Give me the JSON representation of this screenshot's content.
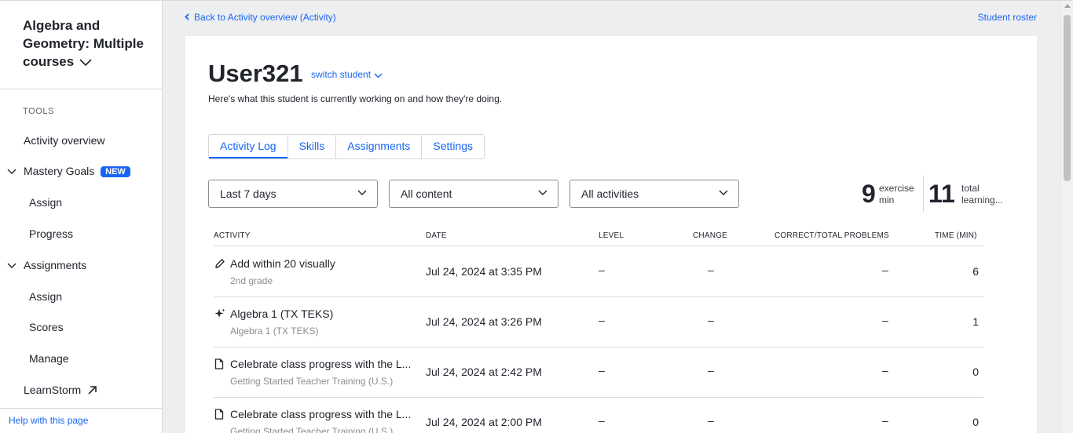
{
  "sidebar": {
    "course_title": "Algebra and Geometry: Multiple courses",
    "tools_label": "TOOLS",
    "activity_overview": "Activity overview",
    "mastery_goals": "Mastery Goals",
    "new_badge": "NEW",
    "mastery_assign": "Assign",
    "mastery_progress": "Progress",
    "assignments": "Assignments",
    "assignments_assign": "Assign",
    "assignments_scores": "Scores",
    "assignments_manage": "Manage",
    "learnstorm": "LearnStorm",
    "help": "Help with this page"
  },
  "header": {
    "back_link": "Back to Activity overview (Activity)",
    "roster_link": "Student roster"
  },
  "student": {
    "name": "User321",
    "switch_label": "switch student",
    "subtitle": "Here's what this student is currently working on and how they're doing."
  },
  "tabs": [
    {
      "label": "Activity Log",
      "active": true
    },
    {
      "label": "Skills",
      "active": false
    },
    {
      "label": "Assignments",
      "active": false
    },
    {
      "label": "Settings",
      "active": false
    }
  ],
  "filters": {
    "period": "Last 7 days",
    "content": "All content",
    "activities": "All activities"
  },
  "stats": {
    "exercise_num": "9",
    "exercise_label_1": "exercise",
    "exercise_label_2": "min",
    "total_num": "11",
    "total_label_1": "total",
    "total_label_2": "learning..."
  },
  "table": {
    "headers": {
      "activity": "ACTIVITY",
      "date": "DATE",
      "level": "LEVEL",
      "change": "CHANGE",
      "correct": "CORRECT/TOTAL PROBLEMS",
      "time": "TIME (MIN)"
    },
    "rows": [
      {
        "icon": "pencil-icon",
        "title": "Add within 20 visually",
        "sub": "2nd grade",
        "date": "Jul 24, 2024 at 3:35 PM",
        "level": "–",
        "change": "–",
        "correct": "–",
        "time": "6"
      },
      {
        "icon": "sparkle-icon",
        "title": "Algebra 1 (TX TEKS)",
        "sub": "Algebra 1 (TX TEKS)",
        "date": "Jul 24, 2024 at 3:26 PM",
        "level": "–",
        "change": "–",
        "correct": "–",
        "time": "1"
      },
      {
        "icon": "document-icon",
        "title": "Celebrate class progress with the L...",
        "sub": "Getting Started Teacher Training (U.S.)",
        "date": "Jul 24, 2024 at 2:42 PM",
        "level": "–",
        "change": "–",
        "correct": "–",
        "time": "0"
      },
      {
        "icon": "document-icon",
        "title": "Celebrate class progress with the L...",
        "sub": "Getting Started Teacher Training (U.S.)",
        "date": "Jul 24, 2024 at 2:00 PM",
        "level": "–",
        "change": "–",
        "correct": "–",
        "time": "0"
      }
    ]
  },
  "colors": {
    "accent": "#1865f2",
    "text": "#21242c",
    "muted": "#8b8d92",
    "background": "#edeef0",
    "border": "#d6d8da"
  }
}
